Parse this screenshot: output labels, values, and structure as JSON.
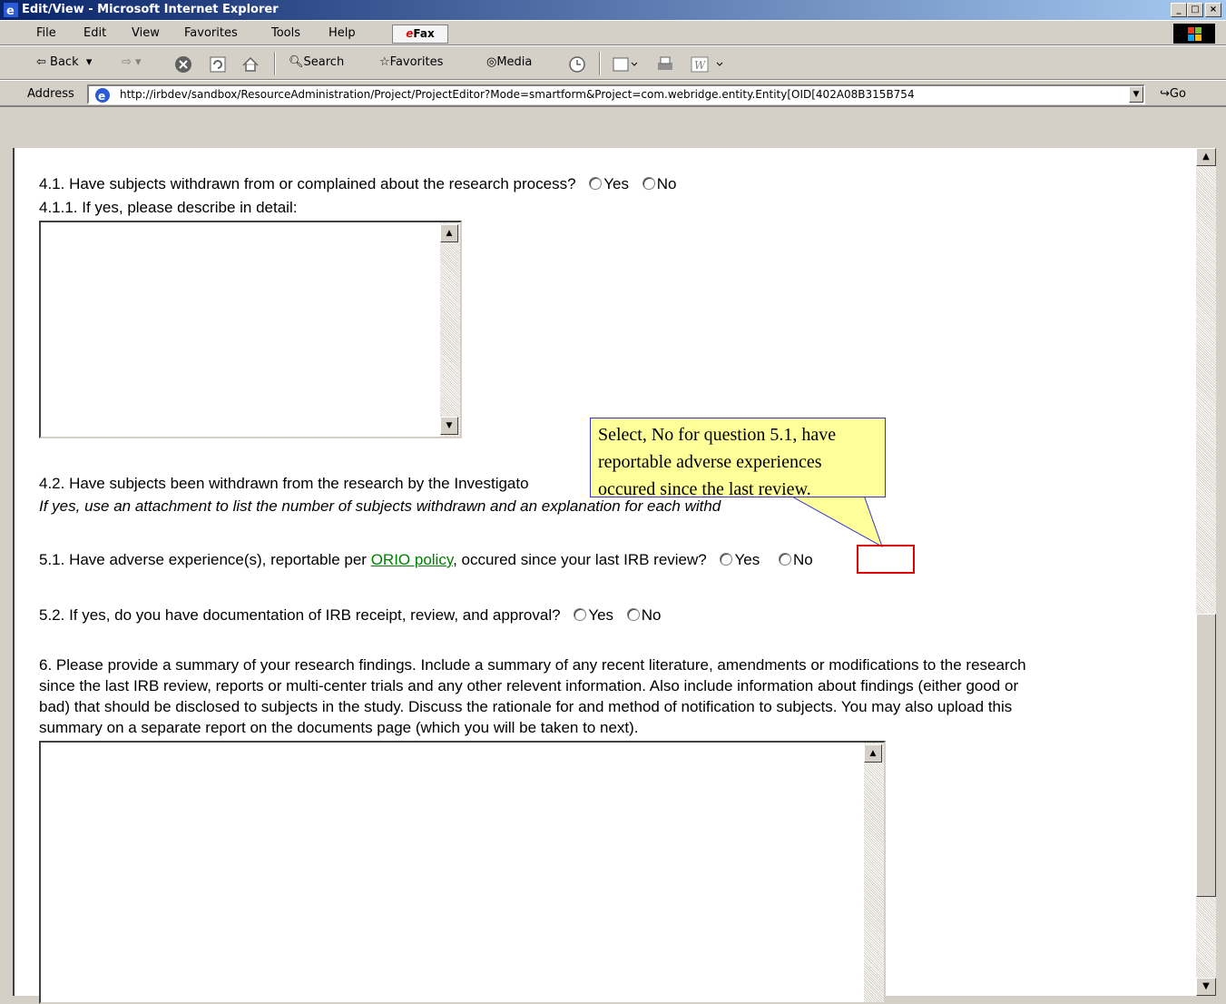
{
  "window": {
    "title": "Edit/View - Microsoft Internet Explorer",
    "min_glyph": "_",
    "max_glyph": "□",
    "close_glyph": "×"
  },
  "menu": {
    "items": [
      "File",
      "Edit",
      "View",
      "Favorites",
      "Tools",
      "Help"
    ],
    "efax_e": "e",
    "efax_rest": "Fax"
  },
  "toolbar": {
    "back_label": "Back",
    "search_label": "Search",
    "favorites_label": "Favorites",
    "media_label": "Media"
  },
  "address": {
    "label": "Address",
    "url": "http://irbdev/sandbox/ResourceAdministration/Project/ProjectEditor?Mode=smartform&Project=com.webridge.entity.Entity[OID[402A08B315B754",
    "go_label": "Go"
  },
  "form": {
    "q41": "4.1.  Have subjects withdrawn from or complained about the research process?",
    "q411": "4.1.1. If yes, please describe in detail:",
    "q42": "4.2.  Have subjects been withdrawn from the research by the Investigato",
    "q42_note": "If yes, use an attachment to list the number of subjects withdrawn and an explanation for each withd",
    "q51_pre": "5.1.  Have adverse experience(s), reportable per",
    "q51_link": "ORIO policy",
    "q51_post": ", occured since your last IRB review?",
    "q52": "5.2.  If yes, do you have documentation of IRB receipt, review, and approval?",
    "q6_lines": [
      "6.  Please provide a summary of your research findings. Include a summary of any recent literature, amendments or modifications to the research",
      "since the last IRB review, reports or multi-center trials and any other relevent information.  Also include information about findings (either good or",
      "bad) that should be disclosed to subjects in the study.  Discuss the rationale for and method of notification to subjects.  You may also upload this",
      "summary on a separate report on the documents page (which you will be taken to next)."
    ],
    "yes": "Yes",
    "no": "No"
  },
  "callout": {
    "text": "Select, No for question 5.1, have reportable adverse experiences occured since the last review."
  }
}
